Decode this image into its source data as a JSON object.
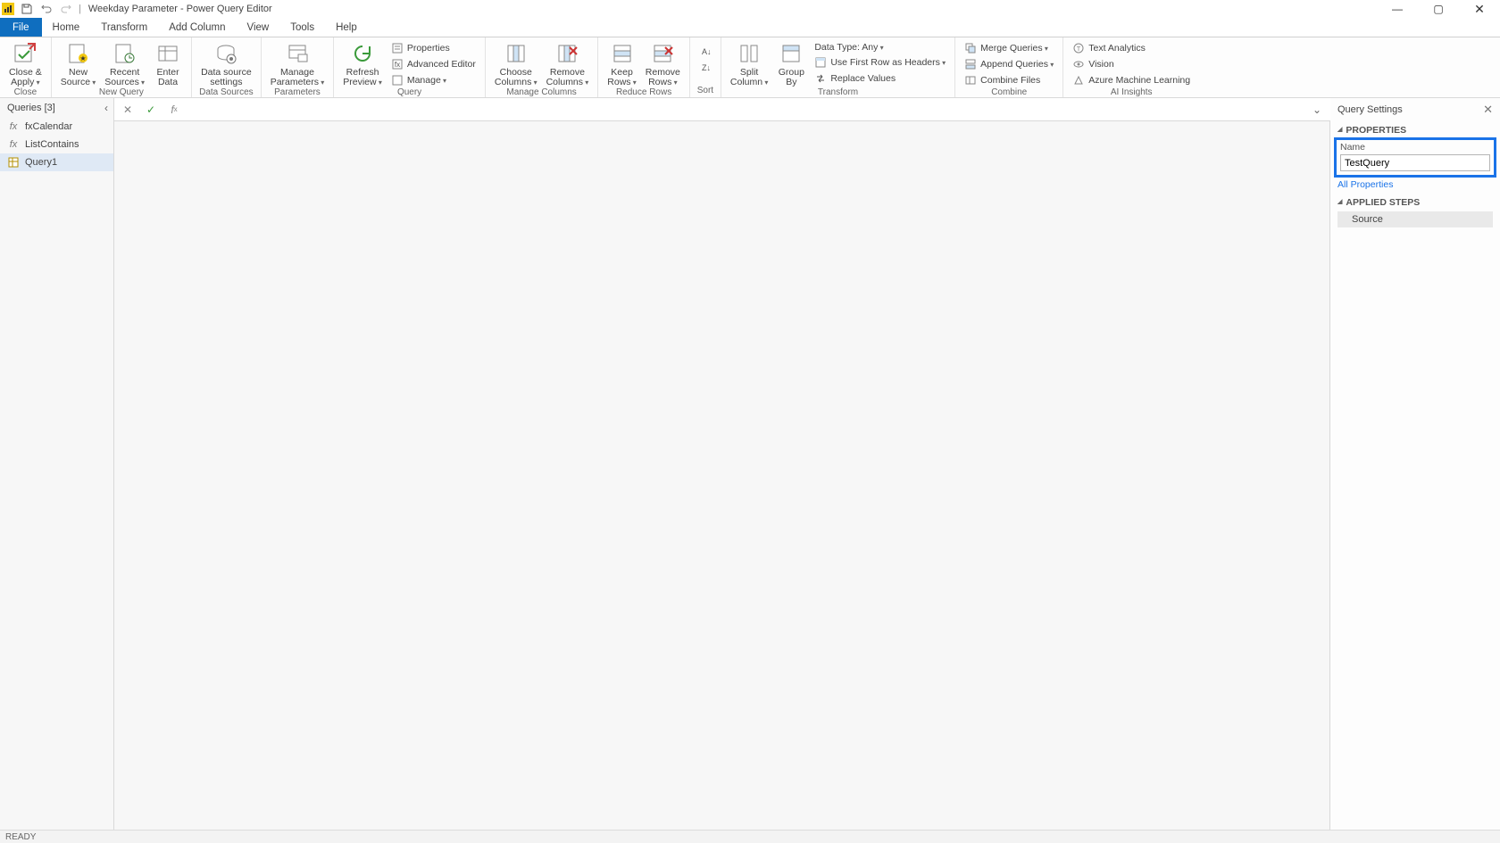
{
  "window": {
    "title": "Weekday Parameter - Power Query Editor"
  },
  "menu": {
    "file": "File",
    "home": "Home",
    "transform": "Transform",
    "add_column": "Add Column",
    "view": "View",
    "tools": "Tools",
    "help": "Help"
  },
  "ribbon": {
    "close": {
      "close_apply": "Close &\nApply",
      "group": "Close"
    },
    "new_query": {
      "new_source": "New\nSource",
      "recent_sources": "Recent\nSources",
      "enter_data": "Enter\nData",
      "group": "New Query"
    },
    "data_sources": {
      "data_source_settings": "Data source\nsettings",
      "group": "Data Sources"
    },
    "parameters": {
      "manage_parameters": "Manage\nParameters",
      "group": "Parameters"
    },
    "query": {
      "refresh_preview": "Refresh\nPreview",
      "properties": "Properties",
      "advanced_editor": "Advanced Editor",
      "manage": "Manage",
      "group": "Query"
    },
    "manage_columns": {
      "choose_columns": "Choose\nColumns",
      "remove_columns": "Remove\nColumns",
      "group": "Manage Columns"
    },
    "reduce_rows": {
      "keep_rows": "Keep\nRows",
      "remove_rows": "Remove\nRows",
      "group": "Reduce Rows"
    },
    "sort": {
      "group": "Sort"
    },
    "transform": {
      "split_column": "Split\nColumn",
      "group_by": "Group\nBy",
      "data_type": "Data Type: Any",
      "first_row_headers": "Use First Row as Headers",
      "replace_values": "Replace Values",
      "group": "Transform"
    },
    "combine": {
      "merge": "Merge Queries",
      "append": "Append Queries",
      "combine_files": "Combine Files",
      "group": "Combine"
    },
    "ai": {
      "text_analytics": "Text Analytics",
      "vision": "Vision",
      "azure_ml": "Azure Machine Learning",
      "group": "AI Insights"
    }
  },
  "queries_pane": {
    "title": "Queries [3]",
    "items": [
      {
        "icon": "fx",
        "label": "fxCalendar"
      },
      {
        "icon": "fx",
        "label": "ListContains"
      },
      {
        "icon": "table",
        "label": "Query1"
      }
    ],
    "selected_index": 2
  },
  "formula_bar": {
    "value": ""
  },
  "settings_pane": {
    "title": "Query Settings",
    "properties_title": "PROPERTIES",
    "name_label": "Name",
    "name_value": "TestQuery",
    "all_properties": "All Properties",
    "applied_steps_title": "APPLIED STEPS",
    "steps": [
      "Source"
    ]
  },
  "statusbar": {
    "text": "READY"
  }
}
